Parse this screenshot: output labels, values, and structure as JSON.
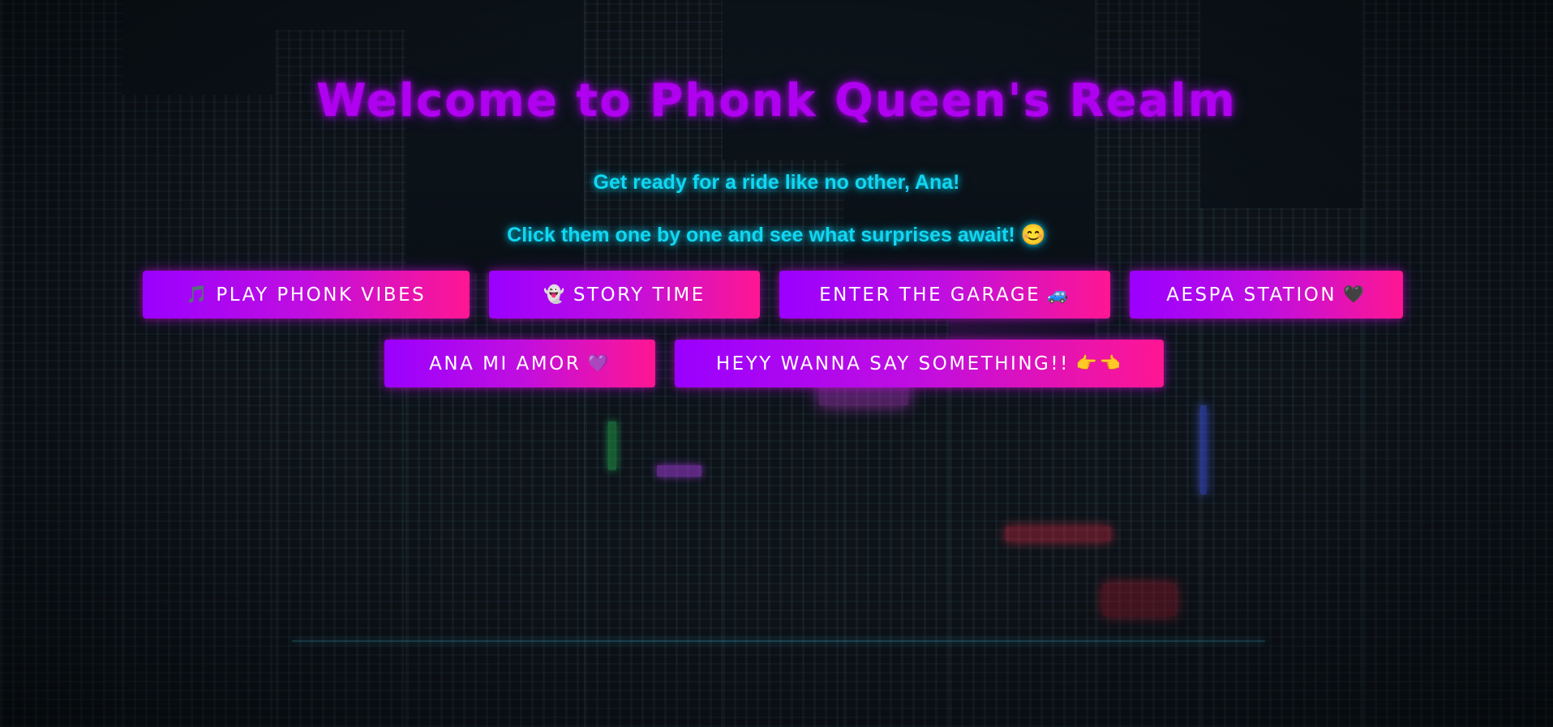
{
  "page": {
    "title": "Welcome to Phonk Queen's Realm",
    "line1": "Get ready for a ride like no other, Ana!",
    "line2": "Click them one by one and see what surprises await! 😊"
  },
  "buttons": [
    {
      "label": "PLAY PHONK VIBES",
      "icon": "🎵",
      "icon_name": "music-note-icon",
      "icon_position": "before"
    },
    {
      "label": "STORY TIME",
      "icon": "👻",
      "icon_name": "ghost-icon",
      "icon_position": "before"
    },
    {
      "label": "ENTER THE GARAGE",
      "icon": "🚙",
      "icon_name": "car-icon",
      "icon_position": "after"
    },
    {
      "label": "AESPA STATION",
      "icon": "🖤",
      "icon_name": "black-heart-icon",
      "icon_position": "after"
    },
    {
      "label": "ANA MI AMOR",
      "icon": "💜",
      "icon_name": "purple-heart-icon",
      "icon_position": "after"
    },
    {
      "label": "HEYY WANNA SAY SOMETHING!!",
      "icon": "👉👈",
      "icon_name": "pointing-fingers-icon",
      "icon_position": "after"
    }
  ],
  "colors": {
    "title": "#b000f0",
    "subtitle": "#12d6f2",
    "button_gradient_start": "#9a00ff",
    "button_gradient_end": "#ff1692"
  }
}
